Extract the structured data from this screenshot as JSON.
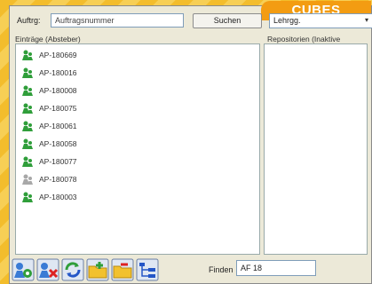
{
  "badge": "CUBES",
  "search": {
    "auftrag_label": "Auftrg:",
    "auftrag_value": "Auftragsnummer",
    "button_label": "Suchen",
    "select_value": "Lehrgg.",
    "select_arrow": "▾"
  },
  "left_header": "Einträge (Absteber)",
  "right_header": "Repositorien (Inaktive",
  "items": [
    {
      "label": "AP-180669",
      "icon": "green-user-icon"
    },
    {
      "label": "AP-180016",
      "icon": "green-user-icon"
    },
    {
      "label": "AP-180008",
      "icon": "green-user-icon"
    },
    {
      "label": "AP-180075",
      "icon": "green-user-icon"
    },
    {
      "label": "AP-180061",
      "icon": "green-user-icon"
    },
    {
      "label": "AP-180058",
      "icon": "green-user-icon"
    },
    {
      "label": "AP-180077",
      "icon": "green-user-icon"
    },
    {
      "label": "AP-180078",
      "icon": "gray-user-icon"
    },
    {
      "label": "AP-180003",
      "icon": "green-user-icon"
    }
  ],
  "find": {
    "label": "Finden",
    "value": "AF 18"
  },
  "colors": {
    "green": "#2f9e3a",
    "gray": "#a8a8a8",
    "badge": "#f39c12"
  }
}
